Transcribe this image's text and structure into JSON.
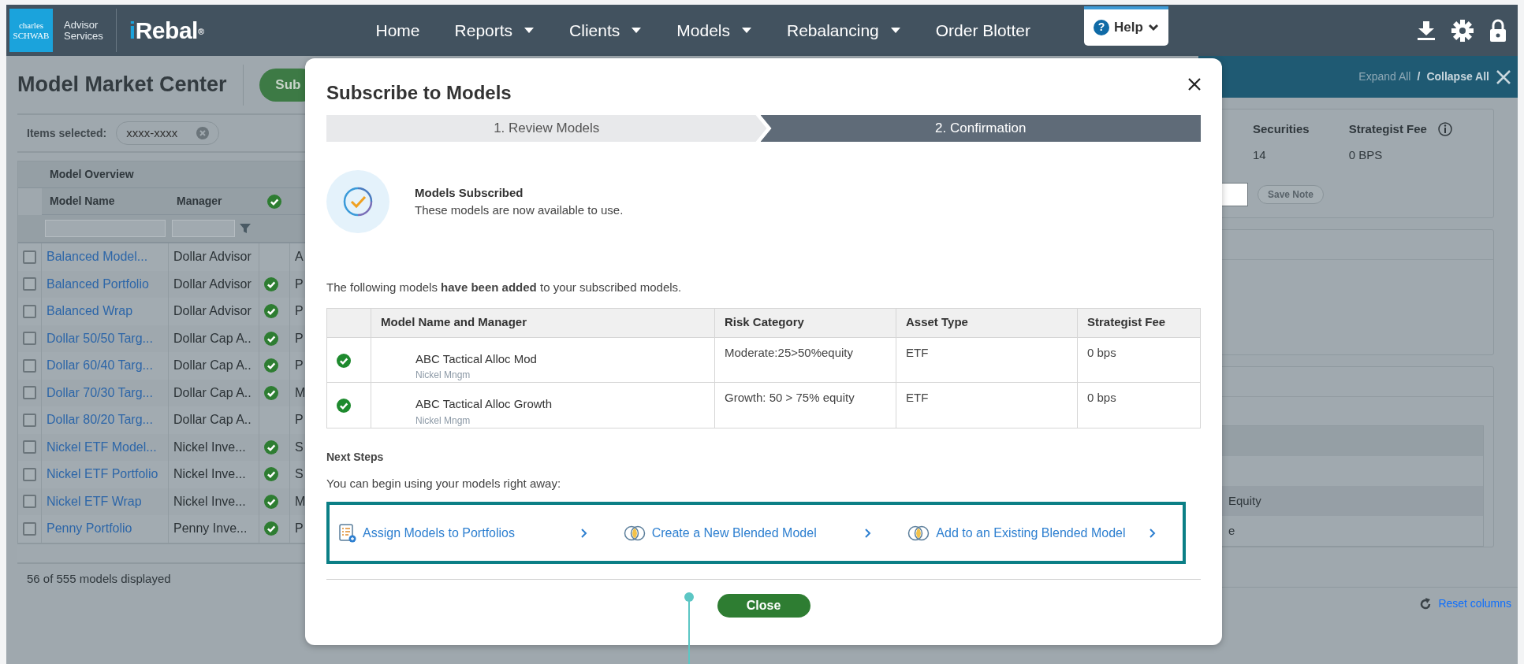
{
  "brand": {
    "logo_line1": "charles",
    "logo_line2": "SCHWAB",
    "sub_line1": "Advisor",
    "sub_line2": "Services",
    "product_initial": "i",
    "product_rest": "Rebal",
    "product_mark": "®"
  },
  "nav_items": [
    {
      "label": "Home",
      "dropdown": false
    },
    {
      "label": "Reports",
      "dropdown": true
    },
    {
      "label": "Clients",
      "dropdown": true
    },
    {
      "label": "Models",
      "dropdown": true
    },
    {
      "label": "Rebalancing",
      "dropdown": true
    },
    {
      "label": "Order Blotter",
      "dropdown": false
    }
  ],
  "help_menu": {
    "icon": "?",
    "label": "Help"
  },
  "page": {
    "title": "Model Market Center",
    "subscribe_button": "Sub"
  },
  "selection": {
    "label": "Items selected:",
    "chip": "xxxx-xxxx"
  },
  "models_table": {
    "group_header": "Model Overview",
    "columns": [
      "Model Name",
      "Manager"
    ],
    "rows": [
      {
        "name": "Balanced Model...",
        "manager": "Dollar Advisor",
        "subscribed": false,
        "checked": false,
        "column_4": "A"
      },
      {
        "name": "Balanced Portfolio",
        "manager": "Dollar Advisor",
        "subscribed": true,
        "checked": false,
        "column_4": "P"
      },
      {
        "name": "Balanced Wrap",
        "manager": "Dollar Advisor",
        "subscribed": true,
        "checked": false,
        "column_4": "P"
      },
      {
        "name": "Dollar 50/50 Targ...",
        "manager": "Dollar Cap A..",
        "subscribed": true,
        "checked": false,
        "column_4": "P"
      },
      {
        "name": "Dollar 60/40 Targ...",
        "manager": "Dollar Cap A..",
        "subscribed": true,
        "checked": false,
        "column_4": "P"
      },
      {
        "name": "Dollar 70/30 Targ...",
        "manager": "Dollar Cap A..",
        "subscribed": true,
        "checked": false,
        "column_4": "M"
      },
      {
        "name": "Dollar 80/20 Targ...",
        "manager": "Dollar Cap A..",
        "subscribed": false,
        "checked": false,
        "column_4": "P"
      },
      {
        "name": "Nickel ETF Model...",
        "manager": "Nickel Inve...",
        "subscribed": true,
        "checked": false,
        "column_4": "S"
      },
      {
        "name": "Nickel ETF Portfolio",
        "manager": "Nickel Inve...",
        "subscribed": true,
        "checked": false,
        "column_4": "S"
      },
      {
        "name": "Nickel ETF Wrap",
        "manager": "Nickel Inve...",
        "subscribed": true,
        "checked": false,
        "column_4": "M"
      },
      {
        "name": "Penny Portfolio",
        "manager": "Penny Inve...",
        "subscribed": true,
        "checked": false,
        "column_4": "P"
      }
    ],
    "footer": "56 of 555 models displayed"
  },
  "details_panel": {
    "expand": "Expand All",
    "separator": "/",
    "collapse": "Collapse All",
    "stats": [
      {
        "label": "Securities",
        "value": "14",
        "info_icon": false
      },
      {
        "label": "Strategist Fee",
        "value": "0 BPS",
        "info_icon": true
      }
    ],
    "save_note": "Save Note",
    "rows": [
      "Equity",
      "e"
    ],
    "reset": "Reset columns"
  },
  "modal": {
    "title": "Subscribe to Models",
    "steps": [
      {
        "label": "1. Review Models",
        "selected": false
      },
      {
        "label": "2. Confirmation",
        "selected": true
      }
    ],
    "status_title": "Models Subscribed",
    "status_text": "These models are now available to use.",
    "intro": "The following models **have been added** to your subscribed models.",
    "table": {
      "columns": [
        "Model Name and Manager",
        "Risk Category",
        "Asset Type",
        "Strategist Fee"
      ],
      "rows": [
        {
          "name": "ABC Tactical Alloc Mod",
          "manager": "Nickel Mngm",
          "risk": "Moderate:25>50%equity",
          "asset_type": "ETF",
          "fee": "0 bps"
        },
        {
          "name": "ABC Tactical Alloc Growth",
          "manager": "Nickel Mngm",
          "risk": "Growth: 50 > 75% equity",
          "asset_type": "ETF",
          "fee": "0 bps"
        }
      ]
    },
    "next_steps_title": "Next Steps",
    "next_steps_text": "You can begin using your models right away:",
    "actions": [
      {
        "label": "Assign Models to Portfolios",
        "kind": "assign"
      },
      {
        "label": "Create a New Blended Model",
        "kind": "blend"
      },
      {
        "label": "Add to an Existing Blended Model",
        "kind": "blend"
      }
    ],
    "close_button": "Close"
  }
}
